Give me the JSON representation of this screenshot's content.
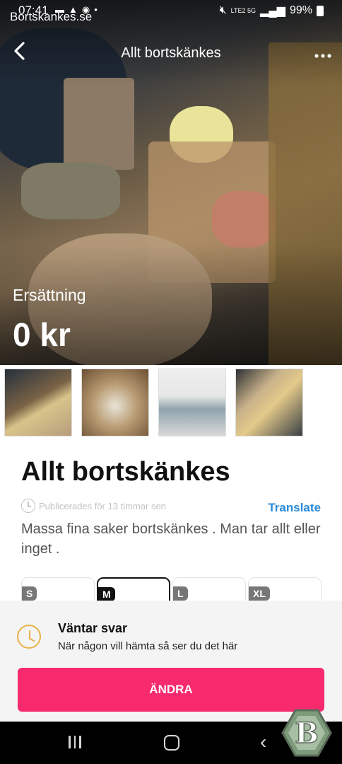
{
  "status_bar": {
    "time": "07:41",
    "battery": "99%",
    "network": "LTE2 5G"
  },
  "watermark": "Bortskankes.se",
  "header": {
    "title": "Allt bortskänkes"
  },
  "hero": {
    "price_label": "Ersättning",
    "price_value": "0 kr"
  },
  "listing": {
    "title": "Allt bortskänkes",
    "published": "Publicerades för  13 timmar sen",
    "translate_label": "Translate",
    "description": "Massa fina saker bortskänkes . Man tar allt eller inget ."
  },
  "sizes": [
    {
      "label": "S",
      "selected": false
    },
    {
      "label": "M",
      "selected": true
    },
    {
      "label": "L",
      "selected": false
    },
    {
      "label": "XL",
      "selected": false
    }
  ],
  "status_sheet": {
    "title": "Väntar svar",
    "subtitle": "När någon vill hämta så ser du det här",
    "button_label": "ÄNDRA"
  },
  "colors": {
    "accent": "#f72a6e",
    "link": "#2a8ad8",
    "pending": "#e8b14a"
  },
  "icons": [
    "back-icon",
    "more-icon",
    "clock-icon",
    "hourglass-icon",
    "recent-apps-icon",
    "home-icon",
    "nav-back-icon",
    "logo-badge"
  ]
}
